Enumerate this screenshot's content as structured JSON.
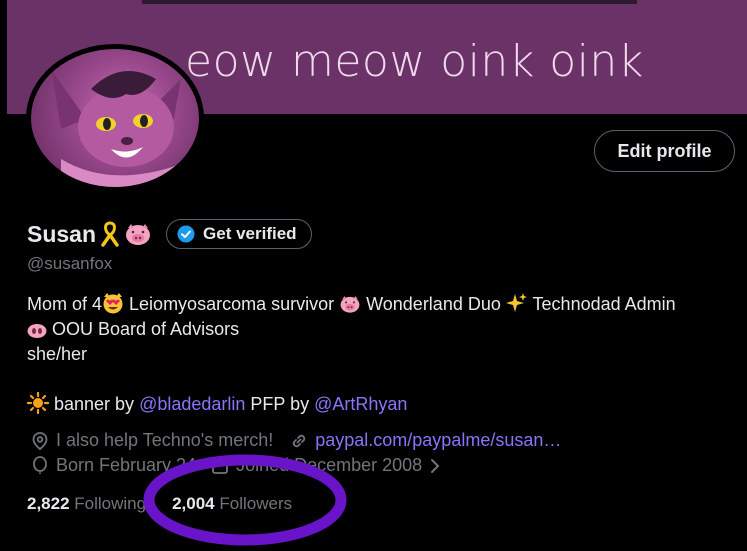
{
  "banner": {
    "text": "eow meow oink oink"
  },
  "profile": {
    "name": "Susan",
    "handle": "@susanfox",
    "edit_label": "Edit profile",
    "verify_label": "Get verified"
  },
  "bio": {
    "line1_a": "Mom of 4",
    "line1_b": " Leiomyosarcoma survivor ",
    "line1_c": " Wonderland Duo ",
    "line1_d": " Technodad Admin",
    "line2": " OOU Board of Advisors",
    "line3": "she/her",
    "line5_a": " banner by ",
    "line5_link1": "@bladedarlin",
    "line5_b": " PFP by ",
    "line5_link2": "@ArtRhyan"
  },
  "meta": {
    "location": "I also help Techno's merch!",
    "website": "paypal.com/paypalme/susan…",
    "born": "Born February 24",
    "joined": "Joined December 2008"
  },
  "stats": {
    "following_count": "2,822",
    "following_label": "Following",
    "followers_count": "2,004",
    "followers_label": "Followers"
  },
  "colors": {
    "banner": "#6b3267",
    "link": "#8d73f7",
    "annotation": "#6a14c9"
  }
}
